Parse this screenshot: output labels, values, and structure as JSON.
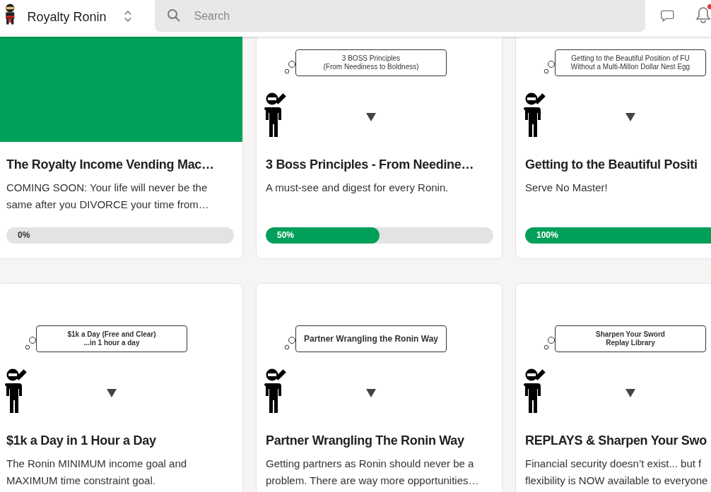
{
  "header": {
    "title": "Royalty Ronin",
    "search": {
      "placeholder": "Search"
    },
    "notifications_unread": true
  },
  "cards": [
    {
      "image": {
        "kind": "solid"
      },
      "title": "The Royalty Income Vending Mac…",
      "description": [
        "COMING SOON: Your life will never be the",
        "same after you DIVORCE your time from…"
      ],
      "progress": {
        "level": 0,
        "label": "0%"
      }
    },
    {
      "image": {
        "kind": "ninja",
        "bubble": [
          "3 BOSS Principles",
          "(From Neediness to Boldness)"
        ],
        "bubble_bold": false
      },
      "title": "3 Boss Principles - From Needine…",
      "description": [
        "A must-see and digest for every Ronin."
      ],
      "progress": {
        "level": 0.5,
        "label": "50%"
      }
    },
    {
      "image": {
        "kind": "ninja",
        "bubble": [
          "Getting to the Beautiful Position of FU",
          "Without a Multi-Millon Dollar Nest Egg"
        ],
        "bubble_bold": false
      },
      "title": "Getting to the Beautiful Positi",
      "description": [
        "Serve No Master!"
      ],
      "progress": {
        "level": 1,
        "label": "100%"
      }
    },
    {
      "image": {
        "kind": "ninja",
        "bubble": [
          "$1k a Day (Free and Clear)",
          "...in 1 hour a day"
        ],
        "bubble_bold": true
      },
      "title": "$1k a Day in 1 Hour a Day",
      "description": [
        "The Ronin MINIMUM income goal and",
        "MAXIMUM time constraint goal."
      ]
    },
    {
      "image": {
        "kind": "ninja",
        "bubble": [
          "Partner Wrangling the Ronin Way"
        ],
        "bubble_bold": true
      },
      "title": "Partner Wrangling The Ronin Way",
      "description": [
        "Getting partners as Ronin should never be a",
        "problem. There are way more opportunities…"
      ]
    },
    {
      "image": {
        "kind": "ninja",
        "bubble": [
          "Sharpen Your Sword",
          "Replay Library"
        ],
        "bubble_bold": true
      },
      "title": "REPLAYS & Sharpen Your Swo",
      "description": [
        "Financial security doesn’t exist... but f",
        "flexibility is NOW available to everyone"
      ]
    }
  ]
}
